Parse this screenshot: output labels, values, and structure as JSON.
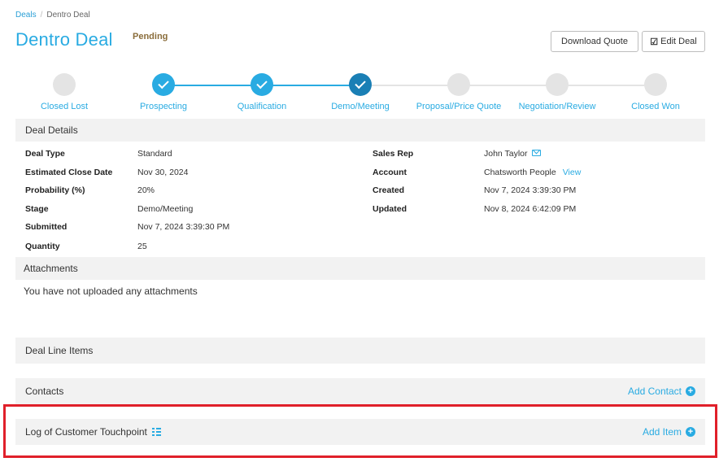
{
  "breadcrumb": {
    "parent": "Deals",
    "current": "Dentro Deal"
  },
  "page": {
    "title": "Dentro Deal",
    "status": "Pending"
  },
  "toolbar": {
    "download_label": "Download Quote",
    "edit_label": "Edit Deal"
  },
  "stages": [
    {
      "label": "Closed Lost",
      "state": "pending"
    },
    {
      "label": "Prospecting",
      "state": "done"
    },
    {
      "label": "Qualification",
      "state": "done"
    },
    {
      "label": "Demo/Meeting",
      "state": "current"
    },
    {
      "label": "Proposal/Price Quote",
      "state": "pending"
    },
    {
      "label": "Negotiation/Review",
      "state": "pending"
    },
    {
      "label": "Closed Won",
      "state": "pending"
    }
  ],
  "deal_details": {
    "header": "Deal Details",
    "left": [
      {
        "label": "Deal Type",
        "value": "Standard"
      },
      {
        "label": "Estimated Close Date",
        "value": "Nov 30, 2024"
      },
      {
        "label": "Probability (%)",
        "value": "20%"
      },
      {
        "label": "Stage",
        "value": "Demo/Meeting"
      },
      {
        "label": "Submitted",
        "value": "Nov 7, 2024 3:39:30 PM"
      },
      {
        "label": "Quantity",
        "value": "25"
      }
    ],
    "right": [
      {
        "label": "Sales Rep",
        "value": "John Taylor"
      },
      {
        "label": "Account",
        "value": "Chatsworth People",
        "link": "View"
      },
      {
        "label": "Created",
        "value": "Nov 7, 2024 3:39:30 PM"
      },
      {
        "label": "Updated",
        "value": "Nov 8, 2024 6:42:09 PM"
      }
    ]
  },
  "attachments": {
    "header": "Attachments",
    "empty": "You have not uploaded any attachments"
  },
  "line_items": {
    "header": "Deal Line Items"
  },
  "contacts": {
    "header": "Contacts",
    "action": "Add Contact"
  },
  "touchpoints": {
    "header": "Log of Customer Touchpoint",
    "action": "Add Item"
  },
  "colors": {
    "accent": "#29abe2",
    "step_current": "#1a7fb5",
    "highlight": "#e0202a",
    "pending": "#8a6d3b"
  }
}
